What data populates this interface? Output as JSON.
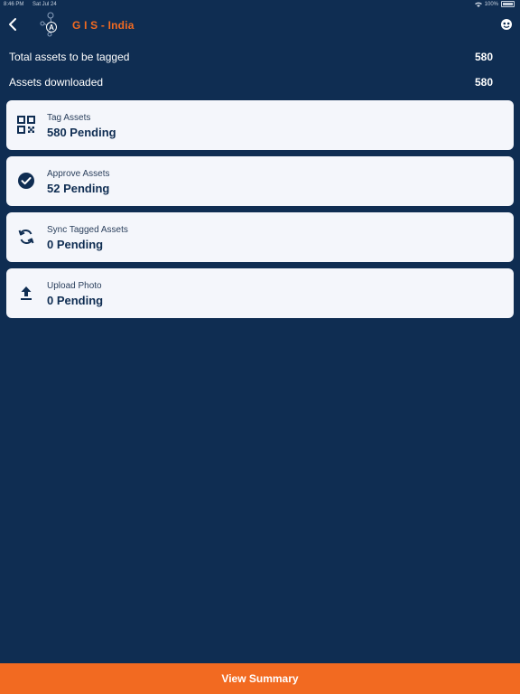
{
  "status_bar": {
    "time": "8:46 PM",
    "date": "Sat Jul 24",
    "battery": "100%"
  },
  "header": {
    "title": "G I S - India",
    "logo_letter": "A"
  },
  "summary": [
    {
      "label": "Total assets to be tagged",
      "value": "580"
    },
    {
      "label": "Assets downloaded",
      "value": "580"
    }
  ],
  "cards": [
    {
      "label": "Tag Assets",
      "value": "580 Pending",
      "icon": "qr-code-icon"
    },
    {
      "label": "Approve Assets",
      "value": "52 Pending",
      "icon": "check-circle-icon"
    },
    {
      "label": "Sync Tagged Assets",
      "value": "0 Pending",
      "icon": "sync-icon"
    },
    {
      "label": "Upload Photo",
      "value": "0 Pending",
      "icon": "upload-icon"
    }
  ],
  "footer": {
    "button_label": "View Summary"
  },
  "colors": {
    "background": "#0f2d52",
    "accent": "#f26a21",
    "card": "#f4f6fb"
  }
}
